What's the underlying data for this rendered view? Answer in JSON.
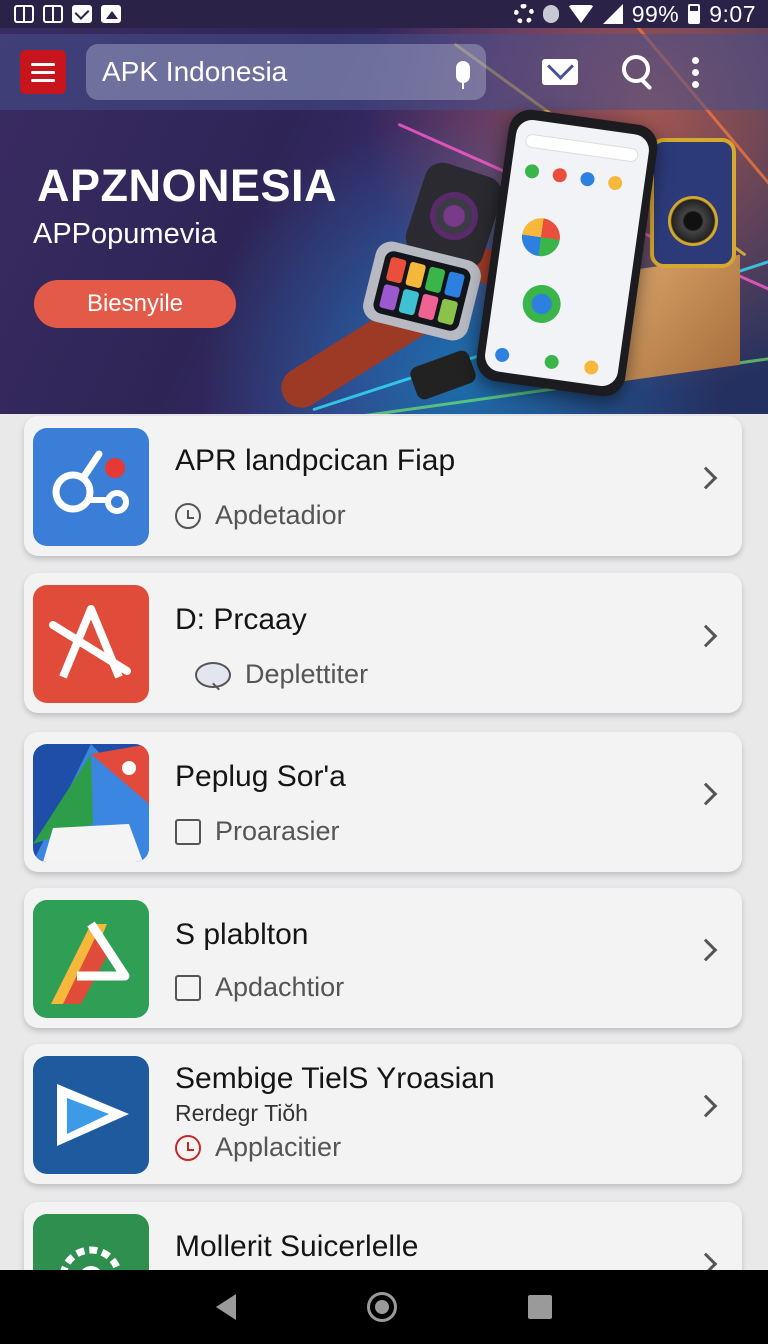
{
  "status_bar": {
    "battery_text": "99%",
    "time": "9:07"
  },
  "toolbar": {
    "search_text": "APK Indonesia"
  },
  "hero": {
    "title": "APZNONESIA",
    "subtitle": "APPopumevia",
    "button_label": "Biesnyile"
  },
  "apps": [
    {
      "title": "APR landpcican Fiap",
      "meta": "Apdetadior",
      "meta_icon": "clock-icon"
    },
    {
      "title": "D: Prcaay",
      "meta": "Deplettiter",
      "meta_icon": "search-icon"
    },
    {
      "title": "Peplug Sor'a",
      "meta": "Proarasier",
      "meta_icon": "square-icon"
    },
    {
      "title": "S plablton",
      "meta": "Apdachtior",
      "meta_icon": "camera-icon"
    },
    {
      "title": "Sembige TielS Yroasian",
      "subtitle": "Rerdegr Tiŏh",
      "meta": "Applacitier",
      "meta_icon": "red-clock-icon"
    },
    {
      "title": "Mollerit Suicerlelle"
    }
  ],
  "colors": {
    "menu_button": "#c8141c",
    "hero_button": "#e35a48",
    "card_bg": "#f3f3f4"
  }
}
